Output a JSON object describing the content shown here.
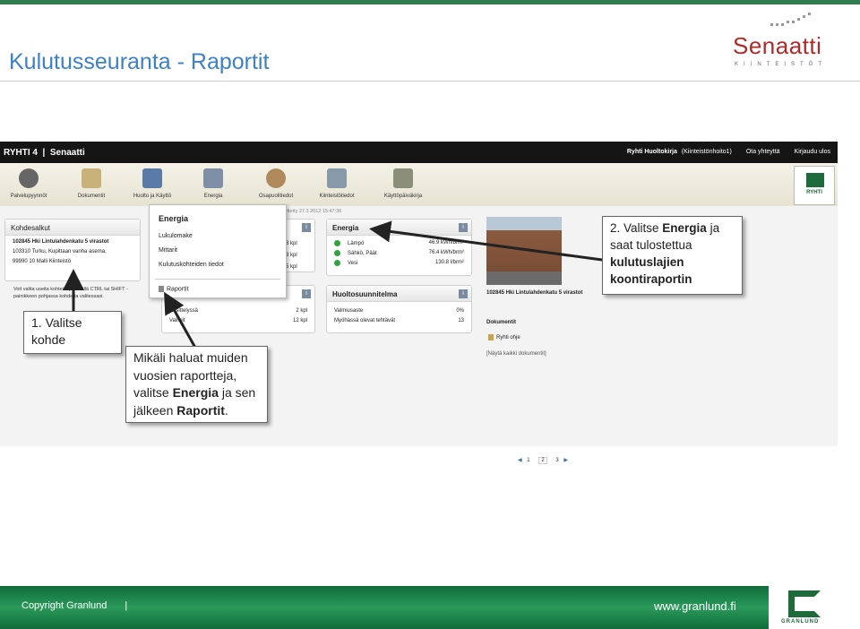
{
  "slide": {
    "title": "Kulutusseuranta - Raportit",
    "logo_text": "Senaatti",
    "logo_sub": "KIINTEISTÖT"
  },
  "app": {
    "nav_left": "RYHTI 4  |  Senaatti",
    "nav_user": "Ryhti Huoltokirja",
    "nav_links": [
      "(Kiinteistönhoito1)",
      "Ota yhteyttä",
      "Kirjaudu ulos"
    ],
    "toolbar": [
      "Palvelupyynnöt",
      "Dokumentit",
      "Huolto ja Käyttö",
      "Energia",
      "Osapuolitiedot",
      "Kiinteistötiedot",
      "Käyttöpäiväkirja"
    ],
    "ryhti_badge": "RYHTI",
    "kohdesalkut": {
      "title": "Kohdesalkut",
      "items": [
        "102845 Hki Lintulahdenkatu 5 virastot",
        "103310 Turku, Kupittaan vanha asema,",
        "99990 10 Malli Kiinteistö"
      ],
      "hint": "Voit valita useita kohteita pitämällä CTRL tai SHIFT -painikkeen pohjassa kohdetta valitessasi."
    },
    "updated": "Päivitetty 27.3.2012 15:47:36",
    "energia_menu": {
      "header": "Energia",
      "items": [
        "Lukulomake",
        "Mittarit",
        "Kulutuskohteiden tiedot"
      ],
      "report": "Raportit"
    },
    "left_counts": {
      "rows_top": [
        "3 kpl",
        "3 kpl",
        "5 kpl"
      ],
      "rows_bottom": [
        {
          "label": "Käsittelyssä",
          "value": "2 kpl"
        },
        {
          "label": "Valmiit",
          "value": "12 kpl"
        }
      ]
    },
    "energia_panel": {
      "title": "Energia",
      "rows": [
        {
          "label": "Lämpö",
          "value": "46.9 kWh/brm²"
        },
        {
          "label": "Sähkö, Päät",
          "value": "76.4 kWh/brm²"
        },
        {
          "label": "Vesi",
          "value": "130.8 l/brm²"
        }
      ]
    },
    "huolto_panel": {
      "title": "Huoltosuunnitelma",
      "rows": [
        {
          "label": "Valmiusaste",
          "value": "0%"
        },
        {
          "label": "Myöhässä olevat tehtävät",
          "value": "13"
        }
      ]
    },
    "building": {
      "caption": "102845 Hki Lintulahdenkatu 5 virastot",
      "docs_title": "Dokumentit",
      "doc_item": "Ryhti ohje",
      "show_all": "[Näytä kaikki dokumentit]"
    },
    "pager": [
      "1",
      "2",
      "3"
    ]
  },
  "callouts": {
    "one_num": "1. Valitse",
    "one_rest": "kohde",
    "two_pre": "2. Valitse ",
    "two_bold": "Energia",
    "two_mid": " ja saat tulostettua",
    "two_bold2": "kulutuslajien koontiraportin",
    "three_pre": "Mikäli haluat muiden vuosien raportteja, valitse ",
    "three_bold": "Energia",
    "three_mid": " ja sen jälkeen ",
    "three_bold2": "Raportit",
    "three_end": "."
  },
  "footer": {
    "copyright": "Copyright Granlund",
    "sep": "|",
    "url": "www.granlund.fi",
    "logo_text": "GRANLUND"
  },
  "colors": {
    "brand_green": "#1d6b3a",
    "title_blue": "#3b80c8",
    "senaatti_red": "#b02a2a"
  }
}
